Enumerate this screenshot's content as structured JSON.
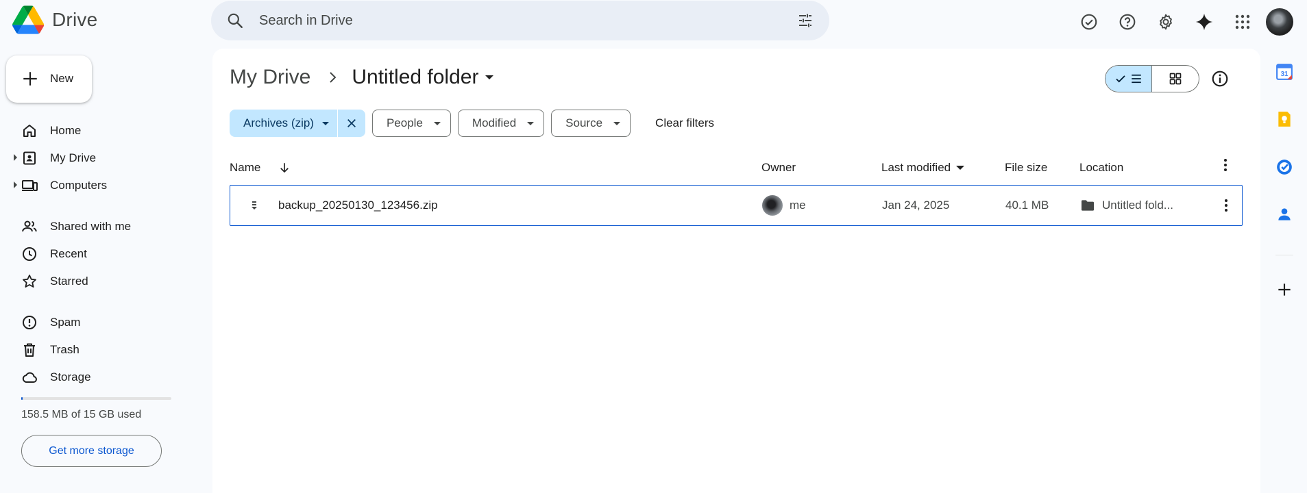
{
  "header": {
    "app_name": "Drive",
    "search_placeholder": "Search in Drive"
  },
  "sidebar": {
    "new_label": "New",
    "items": [
      {
        "label": "Home",
        "icon": "home-icon"
      },
      {
        "label": "My Drive",
        "icon": "my-drive-icon"
      },
      {
        "label": "Computers",
        "icon": "computers-icon"
      },
      {
        "label": "Shared with me",
        "icon": "shared-icon"
      },
      {
        "label": "Recent",
        "icon": "clock-icon"
      },
      {
        "label": "Starred",
        "icon": "star-icon"
      },
      {
        "label": "Spam",
        "icon": "spam-icon"
      },
      {
        "label": "Trash",
        "icon": "trash-icon"
      },
      {
        "label": "Storage",
        "icon": "cloud-icon"
      }
    ],
    "storage_text": "158.5 MB of 15 GB used",
    "storage_used_fraction": 0.0103,
    "get_storage_label": "Get more storage"
  },
  "breadcrumb": {
    "root": "My Drive",
    "current": "Untitled folder"
  },
  "filters": {
    "active": "Archives (zip)",
    "people": "People",
    "modified": "Modified",
    "source": "Source",
    "clear": "Clear filters"
  },
  "table": {
    "headers": {
      "name": "Name",
      "owner": "Owner",
      "last_modified": "Last modified",
      "file_size": "File size",
      "location": "Location"
    },
    "rows": [
      {
        "name": "backup_20250130_123456.zip",
        "owner": "me",
        "modified": "Jan 24, 2025",
        "size": "40.1 MB",
        "location": "Untitled fold..."
      }
    ]
  },
  "colors": {
    "accent": "#0b57d0",
    "chip_active_bg": "#c2e7ff",
    "page_bg": "#f8fafd"
  }
}
